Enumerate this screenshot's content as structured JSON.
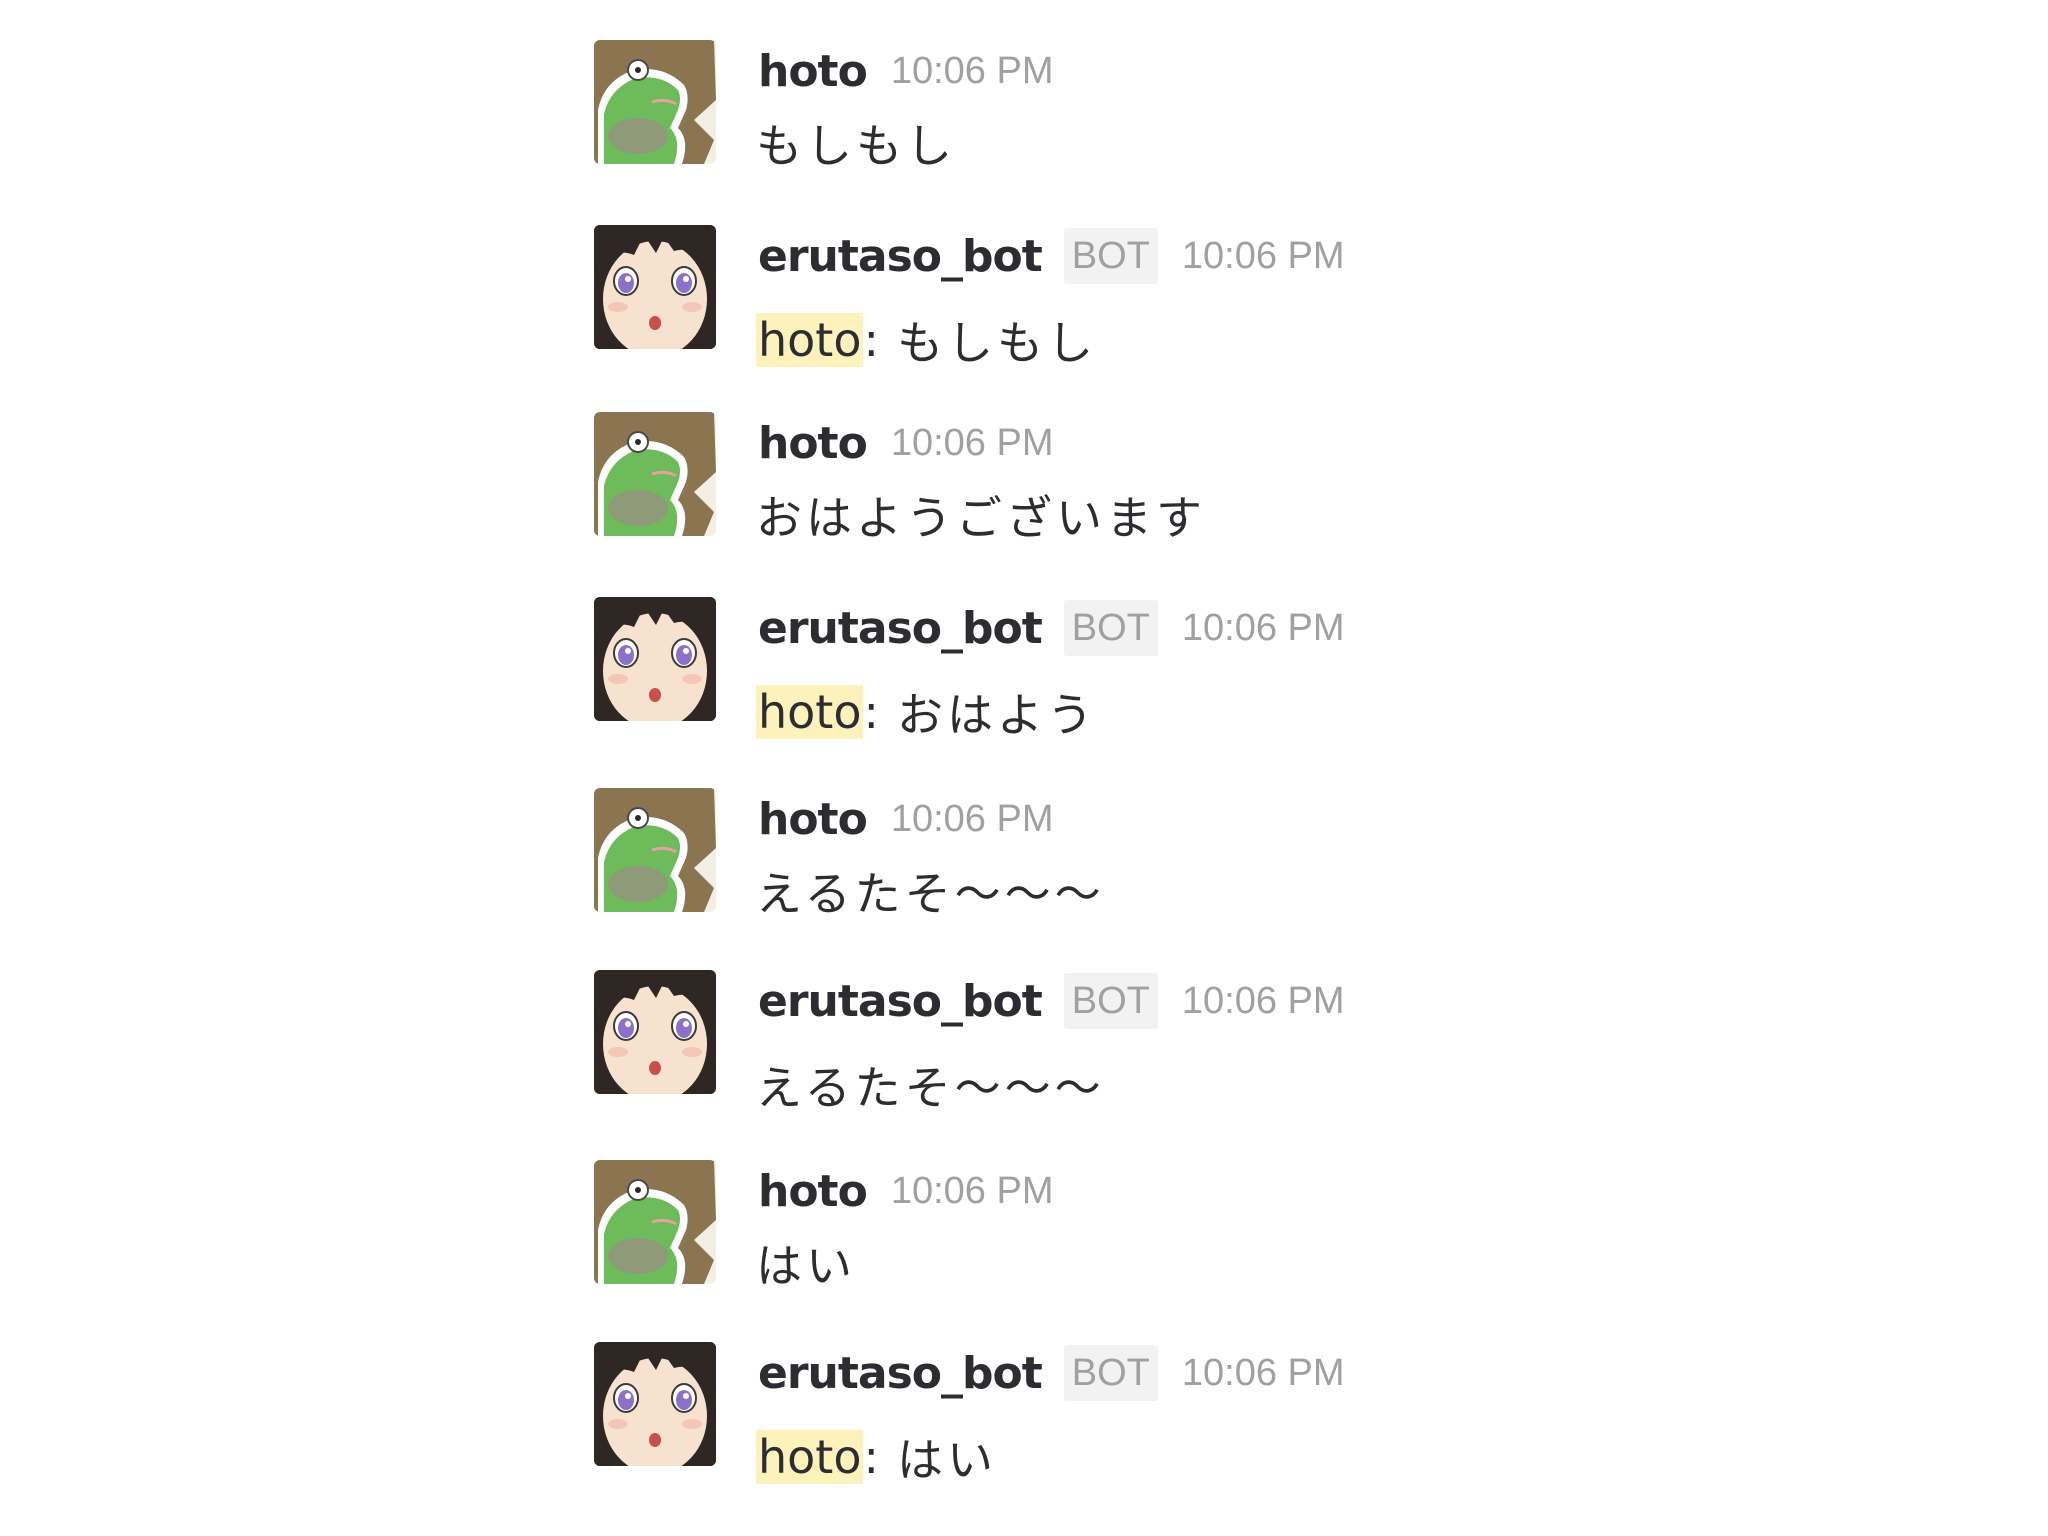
{
  "messages": [
    {
      "author": "hoto",
      "time": "10:06 PM",
      "text": "もしもし"
    },
    {
      "author": "erutaso_bot",
      "badge": "BOT",
      "time": "10:06 PM",
      "mention": "hoto",
      "text": "もしもし"
    },
    {
      "author": "hoto",
      "time": "10:06 PM",
      "text": "おはようございます"
    },
    {
      "author": "erutaso_bot",
      "badge": "BOT",
      "time": "10:06 PM",
      "mention": "hoto",
      "text": "おはよう"
    },
    {
      "author": "hoto",
      "time": "10:06 PM",
      "text": "えるたそ〜〜〜"
    },
    {
      "author": "erutaso_bot",
      "badge": "BOT",
      "time": "10:06 PM",
      "text": "えるたそ〜〜〜"
    },
    {
      "author": "hoto",
      "time": "10:06 PM",
      "text": "はい"
    },
    {
      "author": "erutaso_bot",
      "badge": "BOT",
      "time": "10:06 PM",
      "mention": "hoto",
      "text": "はい"
    }
  ],
  "colors": {
    "name": "#2c2d30",
    "meta": "#a0a0a2",
    "mention_highlight": "#fdf1bc",
    "frog_green": "#6dbb5a",
    "frog_bg": "#8a7550"
  },
  "avatars": {
    "hoto": "frog-avatar",
    "erutaso_bot": "anime-girl-avatar"
  }
}
